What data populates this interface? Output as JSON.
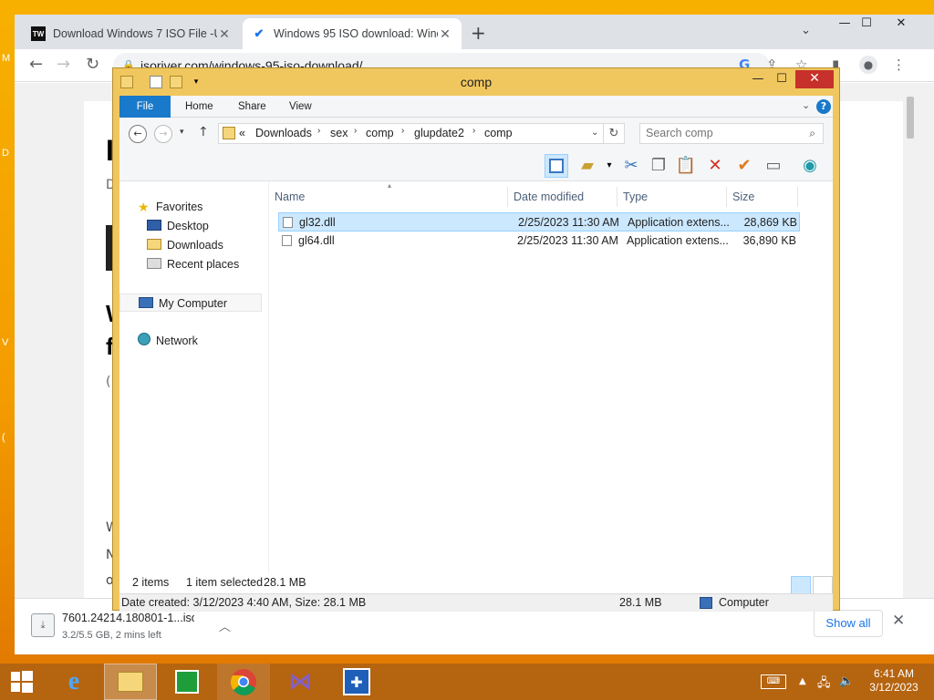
{
  "desktop": {
    "edge_letters": [
      "M",
      "D",
      "V",
      "("
    ]
  },
  "chrome": {
    "tabs": [
      {
        "favicon": "TW",
        "title": "Download Windows 7 ISO File -U",
        "close": "✕"
      },
      {
        "favicon": "✔",
        "title": "Windows 95 ISO download: Wind",
        "close": "✕"
      }
    ],
    "newtab": "+",
    "tabsearch": "⌄",
    "controls": {
      "minimize": "—",
      "maximize": "☐",
      "close": "✕"
    },
    "toolbar": {
      "back": "←",
      "forward": "→",
      "reload": "↻",
      "url": "isoriver.com/windows-95-iso-download/"
    },
    "page_letters": [
      "I",
      "D",
      "W",
      "f",
      "(",
      "W",
      "N",
      "o"
    ],
    "downloads": {
      "name": "7601.24214.180801-1...iso",
      "status": "3.2/5.5 GB, 2 mins left",
      "show_all": "Show all",
      "close": "✕"
    }
  },
  "explorer": {
    "title": "comp",
    "ribbon_tabs": [
      "File",
      "Home",
      "Share",
      "View"
    ],
    "help": "?",
    "address": {
      "prefix": "«",
      "crumbs": [
        "Downloads",
        "sex",
        "comp",
        "glupdate2",
        "comp"
      ]
    },
    "search_placeholder": "Search comp",
    "nav": {
      "favorites": "Favorites",
      "desktop": "Desktop",
      "downloads": "Downloads",
      "recent": "Recent places",
      "my_computer": "My Computer",
      "network": "Network"
    },
    "columns": [
      "Name",
      "Date modified",
      "Type",
      "Size"
    ],
    "files": [
      {
        "name": "gl32.dll",
        "date": "2/25/2023 11:30 AM",
        "type": "Application extens...",
        "size": "28,869 KB",
        "selected": true
      },
      {
        "name": "gl64.dll",
        "date": "2/25/2023 11:30 AM",
        "type": "Application extens...",
        "size": "36,890 KB",
        "selected": false
      }
    ],
    "status": {
      "count": "2 items",
      "selection": "1 item selected",
      "sel_size": "28.1 MB"
    },
    "details": {
      "info": "Date created: 3/12/2023 4:40 AM, Size: 28.1 MB",
      "size": "28.1 MB",
      "location": "Computer"
    }
  },
  "taskbar": {
    "time": "6:41 AM",
    "date": "3/12/2023"
  },
  "colors": {
    "desktop_bg": "#f4a500",
    "explorer_frame": "#f0c75e",
    "ribbon_file": "#1979ca",
    "selection": "#cce8ff",
    "taskbar": "#b56410",
    "close_red": "#c7312b"
  }
}
